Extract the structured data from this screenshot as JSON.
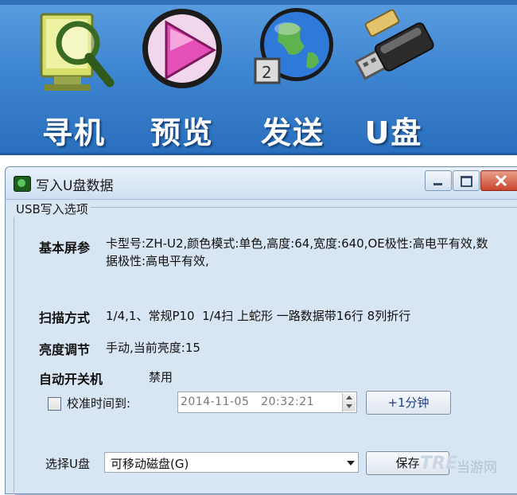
{
  "toolbar": {
    "search": {
      "label": "寻机",
      "icon": "magnifier-monitor-icon"
    },
    "preview": {
      "label": "预览",
      "icon": "play-icon"
    },
    "send": {
      "label": "发送",
      "icon": "globe-send-icon"
    },
    "udisk": {
      "label": "U盘",
      "icon": "usb-drive-icon"
    }
  },
  "window": {
    "title": "写入U盘数据",
    "group_title": "USB写入选项",
    "basic": {
      "label": "基本屏参",
      "value": "卡型号:ZH-U2,颜色模式:单色,高度:64,宽度:640,OE极性:高电平有效,数据极性:高电平有效,"
    },
    "scan": {
      "label": "扫描方式",
      "value": "1/4,1、常规P10  1/4扫 上蛇形 一路数据带16行 8列折行"
    },
    "brightness": {
      "label": "亮度调节",
      "value": "手动,当前亮度:15"
    },
    "auto_power": {
      "label": "自动开关机",
      "value": "禁用"
    },
    "sync_time": {
      "label": "校准时间到:",
      "checked": false,
      "datetime": "2014-11-05   20:32:21",
      "plus_button": "+1分钟"
    },
    "udisk_select": {
      "label": "选择U盘",
      "selected": "可移动磁盘(G)"
    },
    "save_button": "保存"
  },
  "watermark": {
    "logo": "TRE",
    "text": "当游网"
  },
  "colors": {
    "toolbar_bg": "#3f86d2",
    "window_bg": "#d8e5f3",
    "close_button": "#c9452b"
  }
}
